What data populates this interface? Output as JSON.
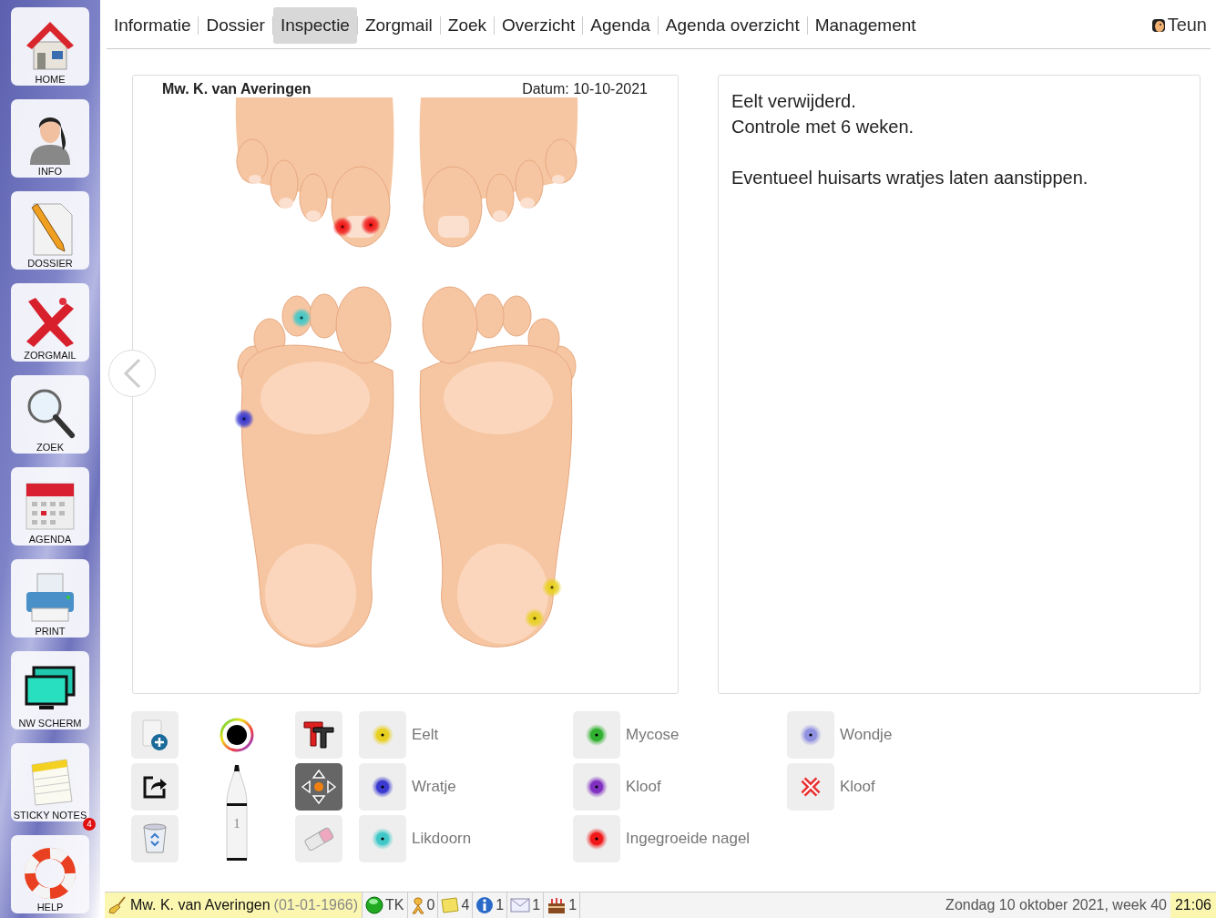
{
  "sidebar": {
    "items": [
      {
        "kind": "home",
        "label": "HOME"
      },
      {
        "kind": "info",
        "label": "INFO"
      },
      {
        "kind": "dossier",
        "label": "DOSSIER"
      },
      {
        "kind": "zorgmail",
        "label": "ZORGMAIL"
      },
      {
        "kind": "zoek",
        "label": "ZOEK"
      },
      {
        "kind": "agenda",
        "label": "AGENDA"
      },
      {
        "kind": "print",
        "label": "PRINT"
      },
      {
        "kind": "screen",
        "label": "NW SCHERM"
      },
      {
        "kind": "notes",
        "label": "STICKY NOTES",
        "badge": "4"
      },
      {
        "kind": "help",
        "label": "HELP"
      }
    ]
  },
  "tabs": [
    {
      "label": "Informatie",
      "selected": false
    },
    {
      "label": "Dossier",
      "selected": false
    },
    {
      "label": "Inspectie",
      "selected": true
    },
    {
      "label": "Zorgmail",
      "selected": false
    },
    {
      "label": "Zoek",
      "selected": false
    },
    {
      "label": "Overzicht",
      "selected": false
    },
    {
      "label": "Agenda",
      "selected": false
    },
    {
      "label": "Agenda overzicht",
      "selected": false
    },
    {
      "label": "Management",
      "selected": false
    }
  ],
  "user": {
    "name": "Teun"
  },
  "chart": {
    "patient": "Mw. K. van Averingen",
    "date": "Datum: 10-10-2021"
  },
  "notes": {
    "paragraphs": [
      {
        "lines": [
          "Eelt verwijderd.",
          "Controle met 6 weken."
        ]
      },
      {
        "lines": [
          "Eventueel huisarts wratjes laten aanstippen."
        ]
      }
    ]
  },
  "tools": [
    {
      "kind": "add-page",
      "selected": false
    },
    {
      "kind": "color",
      "selected": false
    },
    {
      "kind": "text",
      "selected": false
    },
    {
      "kind": "export",
      "selected": false
    },
    {
      "kind": "pen",
      "selected": false,
      "size": "1"
    },
    {
      "kind": "move",
      "selected": true
    },
    {
      "kind": "trash",
      "selected": false
    },
    {
      "kind": "eraser",
      "selected": false
    }
  ],
  "legend": [
    {
      "kind": "dot",
      "label": "Eelt",
      "color": "#e8d020"
    },
    {
      "kind": "dot",
      "label": "Wratje",
      "color": "#3a3ad0"
    },
    {
      "kind": "dot",
      "label": "Likdoorn",
      "color": "#40c8c8"
    },
    {
      "kind": "dot",
      "label": "Mycose",
      "color": "#30b030"
    },
    {
      "kind": "dot",
      "label": "Kloof",
      "color": "#8030c0"
    },
    {
      "kind": "dot",
      "label": "Ingegroeide nagel",
      "color": "#f01818"
    },
    {
      "kind": "dot",
      "label": "Wondje",
      "color": "#9090e0"
    },
    {
      "kind": "cross",
      "label": "Kloof",
      "color": "#e83030"
    }
  ],
  "status_bar": {
    "patient": "Mw. K. van Averingen",
    "birthdate": "(01-01-1966)",
    "items": [
      {
        "kind": "status",
        "text": "TK"
      },
      {
        "kind": "ribbon",
        "text": "0"
      },
      {
        "kind": "notes",
        "text": "4"
      },
      {
        "kind": "info",
        "text": "1"
      },
      {
        "kind": "mail",
        "text": "1"
      },
      {
        "kind": "cake",
        "text": "1"
      }
    ],
    "date": "Zondag 10 oktober 2021, week 40",
    "time": "21:06"
  }
}
